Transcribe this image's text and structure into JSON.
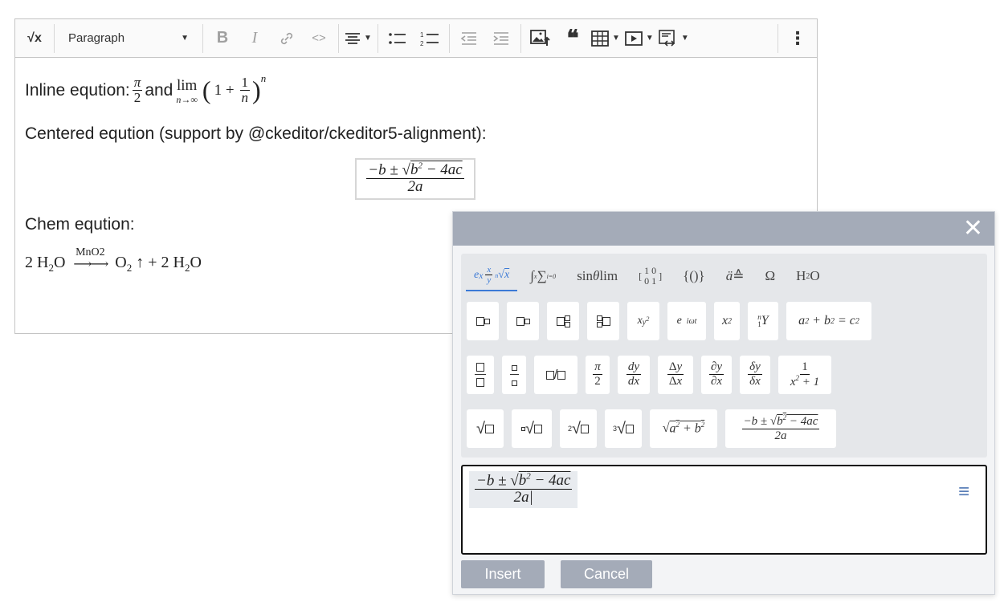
{
  "toolbar": {
    "formula_icon": "√x",
    "heading_select": "Paragraph",
    "bold": "B",
    "italic": "I",
    "code": "<>"
  },
  "content": {
    "line1_prefix": "Inline eqution:",
    "line1_and": "and",
    "line2": "Centered eqution (support by @ckeditor/ckeditor5-alignment):",
    "line3": "Chem eqution:",
    "chem_reagent": "MnO2"
  },
  "dialog": {
    "close": "✕",
    "insert_label": "Insert",
    "cancel_label": "Cancel",
    "tabs": [
      "e^x x/y √x",
      "∫ ∑",
      "sinθ lim",
      "matrix",
      "{()}",
      "ä≙",
      "Ω",
      "H₂O"
    ],
    "menu_icon": "≡"
  },
  "colors": {
    "dialog_header": "#a4abb8",
    "tab_active": "#3c7ad6",
    "button_bg": "#a4abb8"
  }
}
